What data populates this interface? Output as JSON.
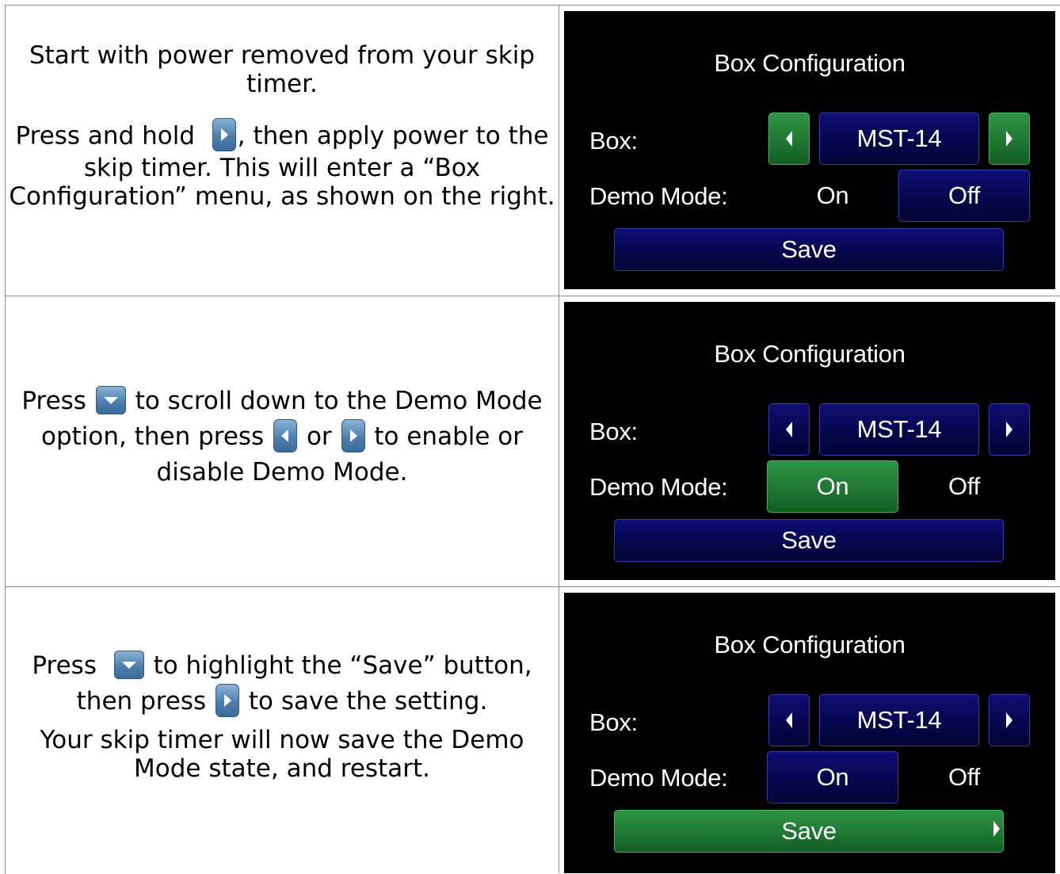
{
  "rows": [
    {
      "instructions": {
        "p1": "Start with power removed from your skip timer.",
        "p2_a": "Press and hold",
        "p2_b": ", then apply power to the skip timer.  This will enter a “Box Configuration” menu, as shown on the right."
      },
      "screen": {
        "title": "Box Configuration",
        "box_label": "Box:",
        "box_value": "MST-14",
        "demo_label": "Demo Mode:",
        "on": "On",
        "off": "Off",
        "save": "Save"
      }
    },
    {
      "instructions": {
        "p1_a": "Press",
        "p1_b": "to scroll down to the Demo Mode option, then press",
        "p1_c": "or",
        "p1_d": "to enable or disable Demo Mode."
      },
      "screen": {
        "title": "Box Configuration",
        "box_label": "Box:",
        "box_value": "MST-14",
        "demo_label": "Demo Mode:",
        "on": "On",
        "off": "Off",
        "save": "Save"
      }
    },
    {
      "instructions": {
        "p1_a": "Press",
        "p1_b": "to highlight the “Save” button, then press",
        "p1_c": "to save the setting.",
        "p2": "Your skip timer will now save the Demo Mode state, and restart."
      },
      "screen": {
        "title": "Box Configuration",
        "box_label": "Box:",
        "box_value": "MST-14",
        "demo_label": "Demo Mode:",
        "on": "On",
        "off": "Off",
        "save": "Save"
      }
    }
  ],
  "icons": {
    "right": "right-arrow-icon",
    "left": "left-arrow-icon",
    "down": "down-arrow-icon"
  },
  "colors": {
    "selected": "#1e7431",
    "button": "#06064a",
    "screen_bg": "#000000"
  }
}
